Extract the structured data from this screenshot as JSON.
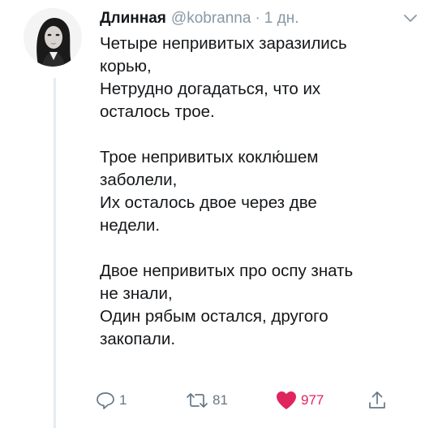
{
  "tweet": {
    "display_name": "Длинная",
    "handle": "@kobranna",
    "separator": "·",
    "time": "1 дн.",
    "stanzas": [
      [
        "Четыре непривитых заразились",
        "корью,",
        "Нетрудно догадаться, что их",
        "осталось трое."
      ],
      [
        "Трое непривитых коклю́шем",
        "заболели,",
        "Их осталось двое через две",
        "недели."
      ],
      [
        "Двое непривитых про оспу знать",
        "не знали,",
        "Один рябым остался, другого",
        "закопали."
      ]
    ]
  },
  "actions": {
    "reply_count": "1",
    "retweet_count": "81",
    "like_count": "977"
  },
  "icons": {
    "avatar": "avatar-photo",
    "caret": "chevron-down-icon",
    "reply": "reply-icon",
    "retweet": "retweet-icon",
    "like": "heart-icon",
    "share": "share-icon"
  },
  "colors": {
    "secondary_text": "#8899a6",
    "action_gray": "#657786",
    "like_red": "#e0245e",
    "thread_line": "#e6ecf0"
  }
}
